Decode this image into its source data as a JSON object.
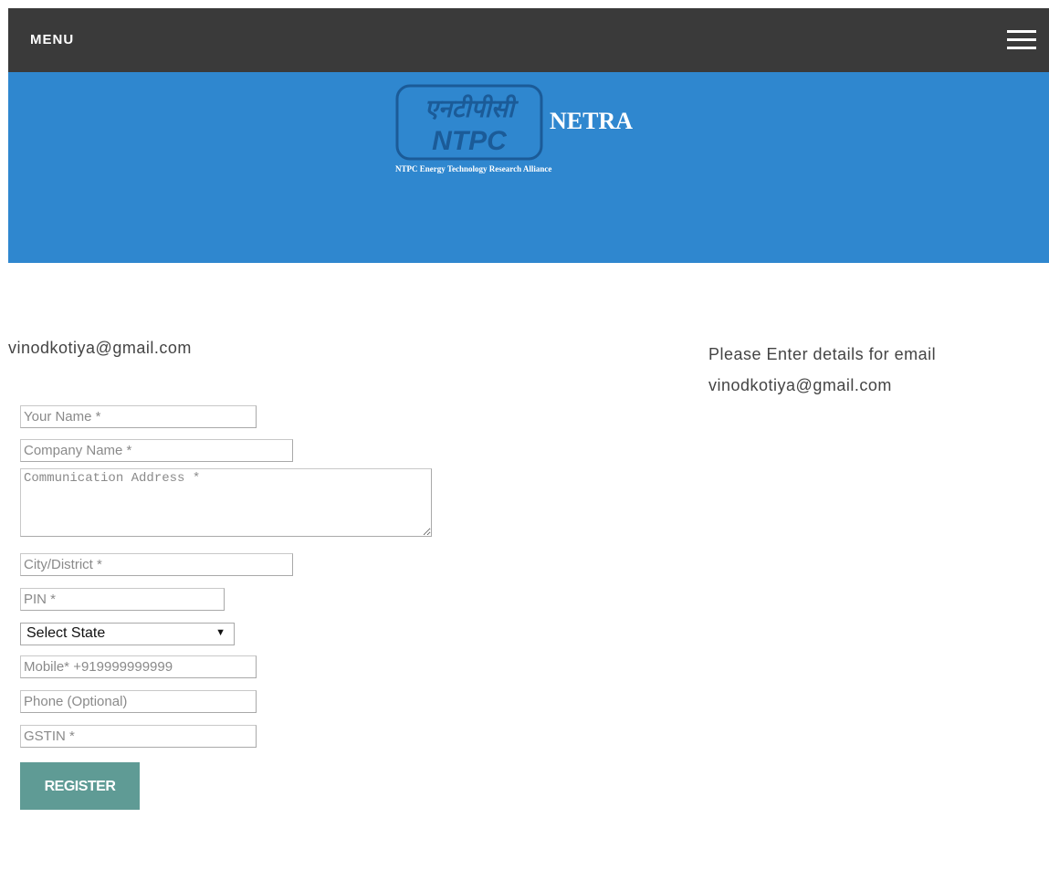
{
  "header": {
    "menu_label": "MENU",
    "hamburger_icon": "hamburger-icon"
  },
  "banner": {
    "background_color": "#2f87cf",
    "logo_icon": "ntpc-logo",
    "logo_text_hindi": "एनटीपीसी",
    "logo_text": "NTPC",
    "brand_name": "NETRA",
    "brand_subtitle": "NTPC Energy Technology Research Alliance"
  },
  "main": {
    "email": "vinodkotiya@gmail.com",
    "info_line1": "Please Enter details for email",
    "info_line2": "vinodkotiya@gmail.com"
  },
  "form": {
    "name_placeholder": "Your Name *",
    "company_placeholder": "Company Name *",
    "address_placeholder": "Communication Address *",
    "city_placeholder": "City/District *",
    "pin_placeholder": "PIN *",
    "state_selected": "Select State",
    "mobile_placeholder": "Mobile* +919999999999",
    "phone_placeholder": "Phone (Optional)",
    "gstin_placeholder": "GSTIN *",
    "register_label": "REGISTER",
    "register_color": "#5f9b95"
  }
}
